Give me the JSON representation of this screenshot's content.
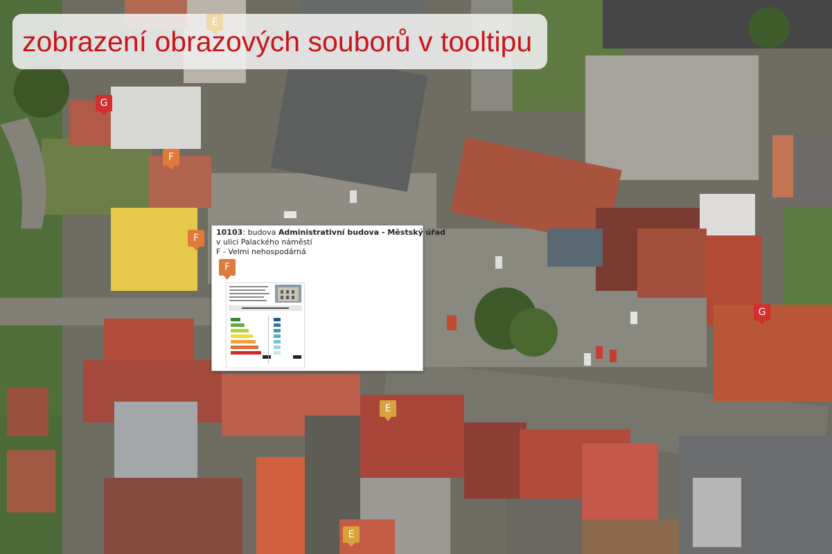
{
  "title": "zobrazení obrazových souborů v tooltipu",
  "colors": {
    "E": "#d9a23c",
    "F": "#e07a3a",
    "G": "#d42f2f",
    "title": "#c8151b"
  },
  "markers": [
    {
      "label": "E",
      "rating": "E"
    },
    {
      "label": "G",
      "rating": "G"
    },
    {
      "label": "F",
      "rating": "F"
    },
    {
      "label": "F",
      "rating": "F"
    },
    {
      "label": "G",
      "rating": "G"
    },
    {
      "label": "E",
      "rating": "E"
    },
    {
      "label": "E",
      "rating": "E"
    }
  ],
  "tooltip": {
    "id": "10103",
    "type_text": "budova",
    "name": "Administrativní budova - Městský úřad",
    "street_prefix": "v ulici",
    "street": "Palackého náměstí",
    "rating_line": "F - Velmi nehospodárná",
    "marker_label": "F",
    "image_icon": "energy-certificate-image"
  }
}
